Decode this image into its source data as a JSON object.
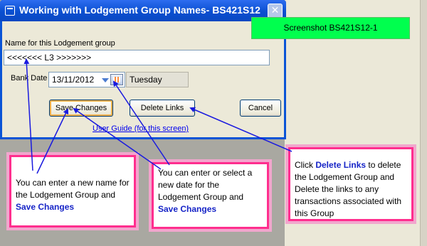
{
  "window": {
    "title": "Working with Lodgement Group Names- BS421S12",
    "close_glyph": "✕"
  },
  "form": {
    "name_label": "Name for this Lodgement group",
    "name_value": "<<<<<<< L3 >>>>>>>",
    "bank_date_label": "Bank Date",
    "bank_date_value": "13/11/2012",
    "weekday_value": "Tuesday"
  },
  "buttons": {
    "save": "Save Changes",
    "delete_links": "Delete Links",
    "cancel": "Cancel"
  },
  "link": {
    "user_guide": "User Guide (for this screen)"
  },
  "tag": {
    "screenshot_id": "Screenshot BS421S12-1"
  },
  "callouts": {
    "name": {
      "text": "You can enter a new name for the Lodgement Group and ",
      "kw": "Save Changes"
    },
    "date": {
      "text": "You can enter or select a new date for the Lodgement Group and ",
      "kw": "Save Changes"
    },
    "delete": {
      "pre": "Click ",
      "kw": "Delete Links",
      "post": " to delete the Lodgement Group and Delete the links to any transactions associated with this Group"
    }
  },
  "colors": {
    "titlebar": "#0a54d6",
    "callout_border": "#ff2e8e",
    "keyword": "#1624c7",
    "tag_bg": "#00ff4e",
    "arrow": "#1a1adf"
  },
  "icons": [
    "app-icon",
    "close-icon",
    "dropdown-arrow-icon",
    "calendar-icon"
  ]
}
